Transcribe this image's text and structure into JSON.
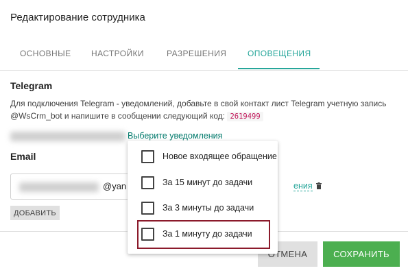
{
  "dialog": {
    "title": "Редактирование сотрудника"
  },
  "tabs": [
    {
      "label": "ОСНОВНЫЕ"
    },
    {
      "label": "НАСТРОЙКИ"
    },
    {
      "label": "РАЗРЕШЕНИЯ"
    },
    {
      "label": "ОПОВЕЩЕНИЯ",
      "active": true
    }
  ],
  "telegram": {
    "heading": "Telegram",
    "description": "Для подключения Telegram - уведомлений, добавьте в свой контакт лист Telegram учетную запись @WsCrm_bot и напишите в сообщении следующий код:",
    "code": "2619499",
    "choose_link": "Выберите уведомления"
  },
  "email": {
    "heading": "Email",
    "domain_visible": "@yan",
    "notifications_link": "ения",
    "trash_icon": "trash-icon",
    "add_button": "ДОБАВИТЬ"
  },
  "footer": {
    "cancel_button": "ОТМЕНА",
    "save_button": "СОХРАНИТЬ"
  },
  "dropdown": {
    "items": [
      {
        "label": "Новое входящее обращение",
        "checked": false
      },
      {
        "label": "За 15 минут до задачи",
        "checked": false
      },
      {
        "label": "За 3 минуты до задачи",
        "checked": false
      },
      {
        "label": "За 1 минуту до задачи",
        "checked": false,
        "highlighted": true
      }
    ]
  },
  "colors": {
    "accent": "#26a69a",
    "save": "#4caf50",
    "code": "#c2185b",
    "highlight_border": "#8b1a2b"
  }
}
